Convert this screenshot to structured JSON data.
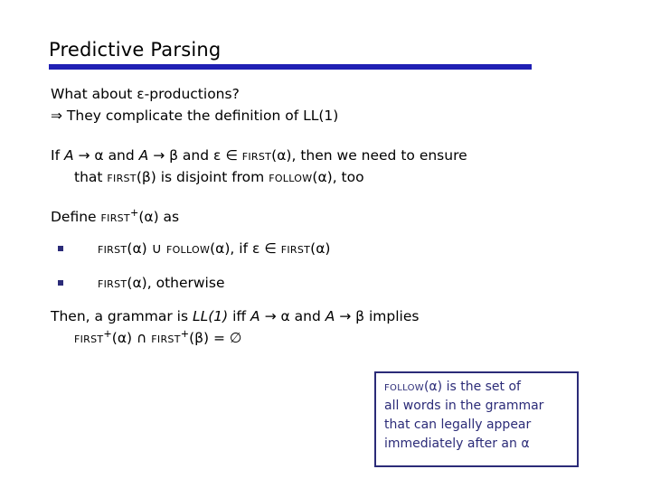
{
  "slide": {
    "title": "Predictive Parsing",
    "accent_color": "#2020b4",
    "callout_color": "#2b2b78",
    "text_color": "#000000",
    "background_color": "#ffffff"
  },
  "blocks": {
    "question": {
      "line1": "What about ε-productions?",
      "line2": "⇒  They complicate the definition of LL(1)"
    },
    "condition": {
      "line1_a": "If ",
      "line1_A1": "A",
      "line1_b": " → α and ",
      "line1_A2": "A",
      "line1_c": " → β and ε ∈ ",
      "line1_first": "First",
      "line1_d": "(α), then we need to ensure",
      "line2_a": "that ",
      "line2_first": "First",
      "line2_b": "(β) is disjoint from ",
      "line2_follow": "Follow",
      "line2_c": "(α), too"
    },
    "define": {
      "prefix": "Define ",
      "name": "First",
      "sup": "+",
      "suffix": "(α) as"
    },
    "bullets": [
      {
        "first1": "First",
        "mid1": "(α) ∪ ",
        "follow": "Follow",
        "mid2": "(α),  if ε ∈ ",
        "first2": "First",
        "tail": "(α)"
      },
      {
        "first1": "First",
        "tail": "(α), otherwise"
      }
    ],
    "then": {
      "line1_a": "Then, a grammar is ",
      "line1_ll": "LL(1)",
      "line1_b": " iff ",
      "line1_A1": "A",
      "line1_c": " → α and ",
      "line1_A2": "A",
      "line1_d": " → β implies",
      "line2_first1": "First",
      "line2_sup1": "+",
      "line2_mid": "(α) ∩ ",
      "line2_first2": "First",
      "line2_sup2": "+",
      "line2_tail": "(β) = ∅"
    }
  },
  "callout": {
    "line1_name": "Follow",
    "line1_rest": "(α) is the set of",
    "line2": "all words in the grammar",
    "line3": "that can legally appear",
    "line4": "immediately after an α"
  }
}
